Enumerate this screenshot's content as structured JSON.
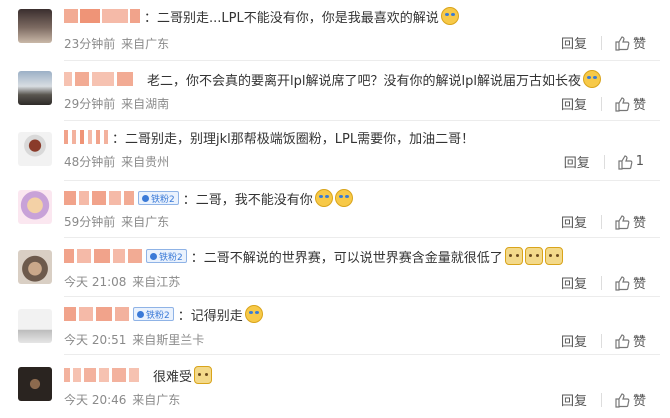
{
  "comments": [
    {
      "text": "：二哥别走...LPL不能没有你，你是我最喜欢的解说",
      "emojis": [
        "cry-emoji"
      ],
      "time": "23分钟前",
      "location": "来自广东",
      "reply_label": "回复",
      "like_label": "赞",
      "badge": ""
    },
    {
      "text": "老二，你不会真的要离开lpl解说席了吧？没有你的解说lpl解说届万古如长夜",
      "emojis": [
        "cry-emoji"
      ],
      "time": "29分钟前",
      "location": "来自湖南",
      "reply_label": "回复",
      "like_label": "赞",
      "badge": ""
    },
    {
      "text": "：二哥别走，别理jkl那帮极端饭圈粉，LPL需要你，加油二哥！",
      "emojis": [],
      "time": "48分钟前",
      "location": "来自贵州",
      "reply_label": "回复",
      "like_label": "1",
      "badge": ""
    },
    {
      "text": "：二哥，我不能没有你",
      "emojis": [
        "cry-emoji",
        "cry-emoji"
      ],
      "time": "59分钟前",
      "location": "来自广东",
      "reply_label": "回复",
      "like_label": "赞",
      "badge": "铁粉2"
    },
    {
      "text": "：二哥不解说的世界赛，可以说世界赛含金量就很低了",
      "emojis": [
        "cat-emoji",
        "cat-emoji",
        "cat-emoji"
      ],
      "time": "今天 21:08",
      "location": "来自江苏",
      "reply_label": "回复",
      "like_label": "赞",
      "badge": "铁粉2"
    },
    {
      "text": "：记得别走",
      "emojis": [
        "cry-emoji"
      ],
      "time": "今天 20:51",
      "location": "来自斯里兰卡",
      "reply_label": "回复",
      "like_label": "赞",
      "badge": "铁粉2"
    },
    {
      "text": "很难受",
      "emojis": [
        "cat-emoji"
      ],
      "time": "今天 20:46",
      "location": "来自广东",
      "reply_label": "回复",
      "like_label": "赞",
      "badge": ""
    }
  ],
  "colors": {
    "username": "#e8663d",
    "badge": "#3b7ad7",
    "meta": "#8a8a8a"
  }
}
